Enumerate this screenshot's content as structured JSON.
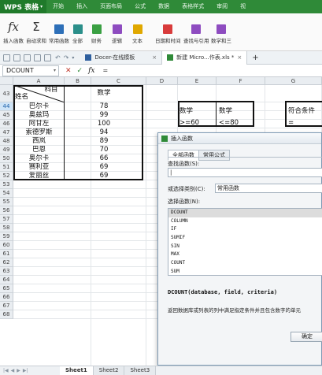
{
  "title_bar": {
    "app_name": "WPS 表格",
    "menu_tabs": [
      "开始",
      "插入",
      "页面布局",
      "公式",
      "数据",
      "表格样式",
      "审阅",
      "视"
    ]
  },
  "ribbon": {
    "buttons": [
      {
        "label": "插入函数",
        "icon": "fx-icon"
      },
      {
        "label": "自动求和",
        "icon": "sigma-icon"
      },
      {
        "label": "常用函数",
        "icon": "common-func-icon"
      },
      {
        "label": "全部",
        "icon": "all-func-icon"
      },
      {
        "label": "财务",
        "icon": "finance-icon"
      },
      {
        "label": "逻辑",
        "icon": "logic-icon"
      },
      {
        "label": "文本",
        "icon": "text-func-icon"
      },
      {
        "label": "日期和时间",
        "icon": "datetime-icon"
      },
      {
        "label": "查找与引用",
        "icon": "lookup-icon"
      },
      {
        "label": "数学和三",
        "icon": "math-icon"
      }
    ],
    "colors": {
      "green": "#3aa043",
      "yellow": "#e0a800",
      "purple": "#8e4cc0",
      "red": "#d83b3b",
      "blue": "#2d6fb8",
      "teal": "#2b8f8a"
    }
  },
  "doc_tabs": [
    {
      "label": "Docer-在线模板",
      "active": false
    },
    {
      "label": "新建 Micro...作表.xls *",
      "active": true
    }
  ],
  "formula_bar": {
    "name_box": "DCOUNT",
    "fx_label": "fx",
    "content": "="
  },
  "columns": [
    "A",
    "B",
    "C",
    "D",
    "E",
    "F",
    "G"
  ],
  "rows": [
    "43",
    "44",
    "45",
    "46",
    "47",
    "48",
    "49",
    "50",
    "51",
    "52",
    "53",
    "54",
    "55",
    "56",
    "57",
    "58",
    "59",
    "60",
    "61",
    "62",
    "63",
    "64",
    "65",
    "66",
    "67",
    "68"
  ],
  "table": {
    "header_subject": "科目",
    "header_name": "姓名",
    "header_score": "数学",
    "records": [
      {
        "name": "巴尔卡",
        "score": "78"
      },
      {
        "name": "奥兹玛",
        "score": "99"
      },
      {
        "name": "阿甘左",
        "score": "100"
      },
      {
        "name": "索德罗斯",
        "score": "94"
      },
      {
        "name": "西岚",
        "score": "89"
      },
      {
        "name": "巴恩",
        "score": "70"
      },
      {
        "name": "奥尔卡",
        "score": "66"
      },
      {
        "name": "赛利亚",
        "score": "69"
      },
      {
        "name": "爱丽丝",
        "score": "69"
      }
    ]
  },
  "criteria": {
    "header_1": "数学",
    "header_2": "数学",
    "value_1": ">=60",
    "value_2": "<=80",
    "result_header": "符合条件",
    "result_value": "="
  },
  "dialog": {
    "title": "插入函数",
    "tabs": [
      "全部函数",
      "常用公式"
    ],
    "search_label": "查找函数(S):",
    "search_value": "|",
    "category_label": "或选择类别(C):",
    "category_value": "常用函数",
    "select_label": "选择函数(N):",
    "functions": [
      "DCOUNT",
      "COLUMN",
      "IF",
      "SUMIF",
      "SIN",
      "MAX",
      "COUNT",
      "SUM"
    ],
    "selected_function": "DCOUNT",
    "signature": "DCOUNT(database, field, criteria)",
    "description": "返回数据库或列表的列中满足指定条件并且包含数字的单元",
    "ok_label": "确定"
  },
  "sheet_tabs": [
    {
      "label": "Sheet1",
      "active": true
    },
    {
      "label": "Sheet2",
      "active": false
    },
    {
      "label": "Sheet3",
      "active": false
    }
  ]
}
